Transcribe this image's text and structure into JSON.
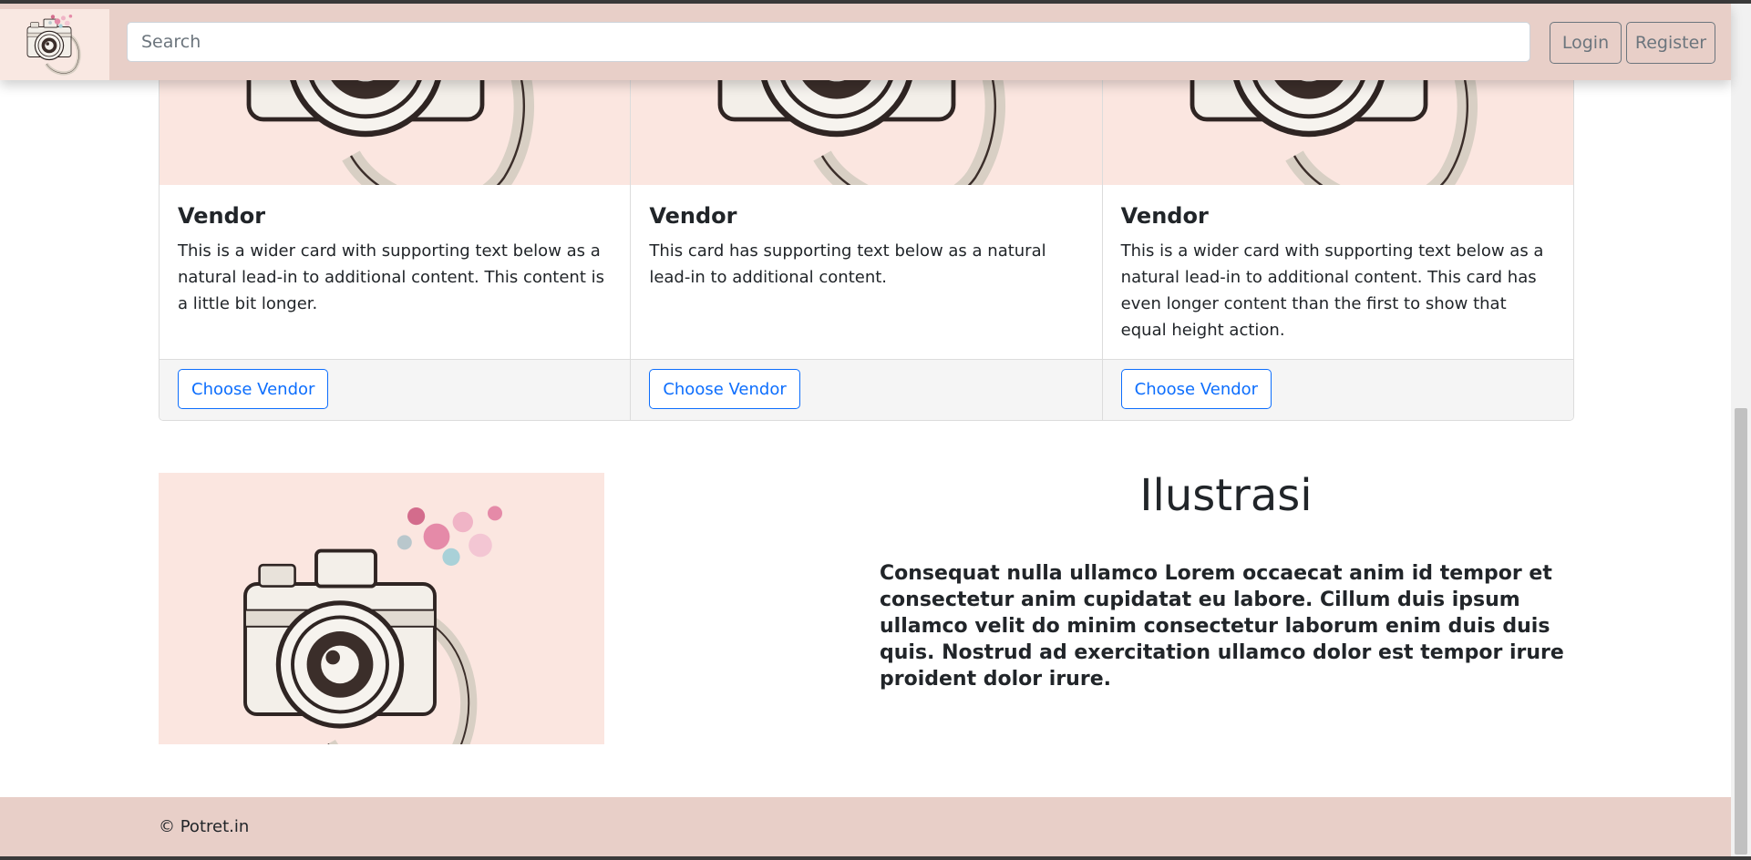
{
  "navbar": {
    "logo_icon": "camera-icon",
    "search_placeholder": "Search",
    "login_label": "Login",
    "register_label": "Register"
  },
  "cards": [
    {
      "title": "Vendor",
      "text": "This is a wider card with supporting text below as a natural lead-in to additional content. This content is a little bit longer.",
      "button_label": "Choose Vendor"
    },
    {
      "title": "Vendor",
      "text": "This card has supporting text below as a natural lead-in to additional content.",
      "button_label": "Choose Vendor"
    },
    {
      "title": "Vendor",
      "text": "This is a wider card with supporting text below as a natural lead-in to additional content. This card has even longer content than the first to show that equal height action.",
      "button_label": "Choose Vendor"
    }
  ],
  "illustration": {
    "title": "Ilustrasi",
    "text": "Consequat nulla ullamco Lorem occaecat anim id tempor et consectetur anim cupidatat eu labore. Cillum duis ipsum ullamco velit do minim consectetur laborum enim duis duis quis. Nostrud ad exercitation ullamco dolor est tempor irure proident dolor irure."
  },
  "footer": {
    "text": "© Potret.in"
  },
  "colors": {
    "navbar_bg": "#e8cfc8",
    "image_bg": "#fbe6e0",
    "accent": "#0d6efd"
  }
}
